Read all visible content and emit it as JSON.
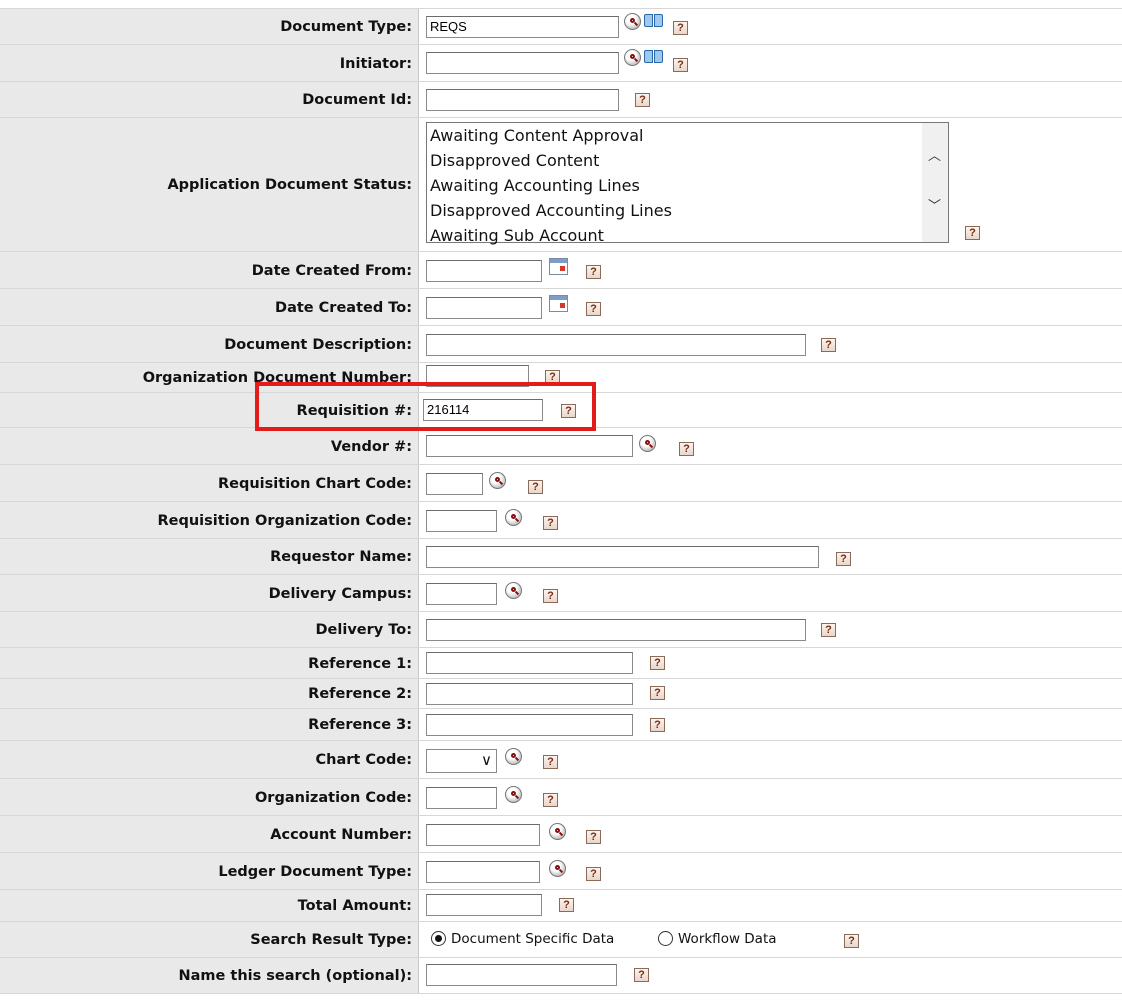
{
  "fields": {
    "document_type": {
      "label": "Document Type:",
      "value": "REQS"
    },
    "initiator": {
      "label": "Initiator:",
      "value": ""
    },
    "document_id": {
      "label": "Document Id:",
      "value": ""
    },
    "app_doc_status": {
      "label": "Application Document Status:",
      "options": [
        "Awaiting Content Approval",
        "Disapproved Content",
        "Awaiting Accounting Lines",
        "Disapproved Accounting Lines",
        "Awaiting Sub Account"
      ]
    },
    "date_created_from": {
      "label": "Date Created From:",
      "value": ""
    },
    "date_created_to": {
      "label": "Date Created To:",
      "value": ""
    },
    "document_description": {
      "label": "Document Description:",
      "value": ""
    },
    "org_document_number": {
      "label": "Organization Document Number:",
      "value": ""
    },
    "requisition_number": {
      "label": "Requisition #:",
      "value": "216114"
    },
    "vendor_number": {
      "label": "Vendor #:",
      "value": ""
    },
    "requisition_chart_code": {
      "label": "Requisition Chart Code:",
      "value": ""
    },
    "requisition_org_code": {
      "label": "Requisition Organization Code:",
      "value": ""
    },
    "requestor_name": {
      "label": "Requestor Name:",
      "value": ""
    },
    "delivery_campus": {
      "label": "Delivery Campus:",
      "value": ""
    },
    "delivery_to": {
      "label": "Delivery To:",
      "value": ""
    },
    "reference_1": {
      "label": "Reference 1:",
      "value": ""
    },
    "reference_2": {
      "label": "Reference 2:",
      "value": ""
    },
    "reference_3": {
      "label": "Reference 3:",
      "value": ""
    },
    "chart_code": {
      "label": "Chart Code:",
      "value": ""
    },
    "organization_code": {
      "label": "Organization Code:",
      "value": ""
    },
    "account_number": {
      "label": "Account Number:",
      "value": ""
    },
    "ledger_document_type": {
      "label": "Ledger Document Type:",
      "value": ""
    },
    "total_amount": {
      "label": "Total Amount:",
      "value": ""
    },
    "search_result_type": {
      "label": "Search Result Type:",
      "options": [
        {
          "label": "Document Specific Data",
          "selected": true
        },
        {
          "label": "Workflow Data",
          "selected": false
        }
      ]
    },
    "search_name": {
      "label": "Name this search (optional):",
      "value": ""
    }
  },
  "help_glyph": "?",
  "colors": {
    "label_bg": "#e9e9e9",
    "highlight": "#e41b1b",
    "help_text": "#7a2c12"
  }
}
